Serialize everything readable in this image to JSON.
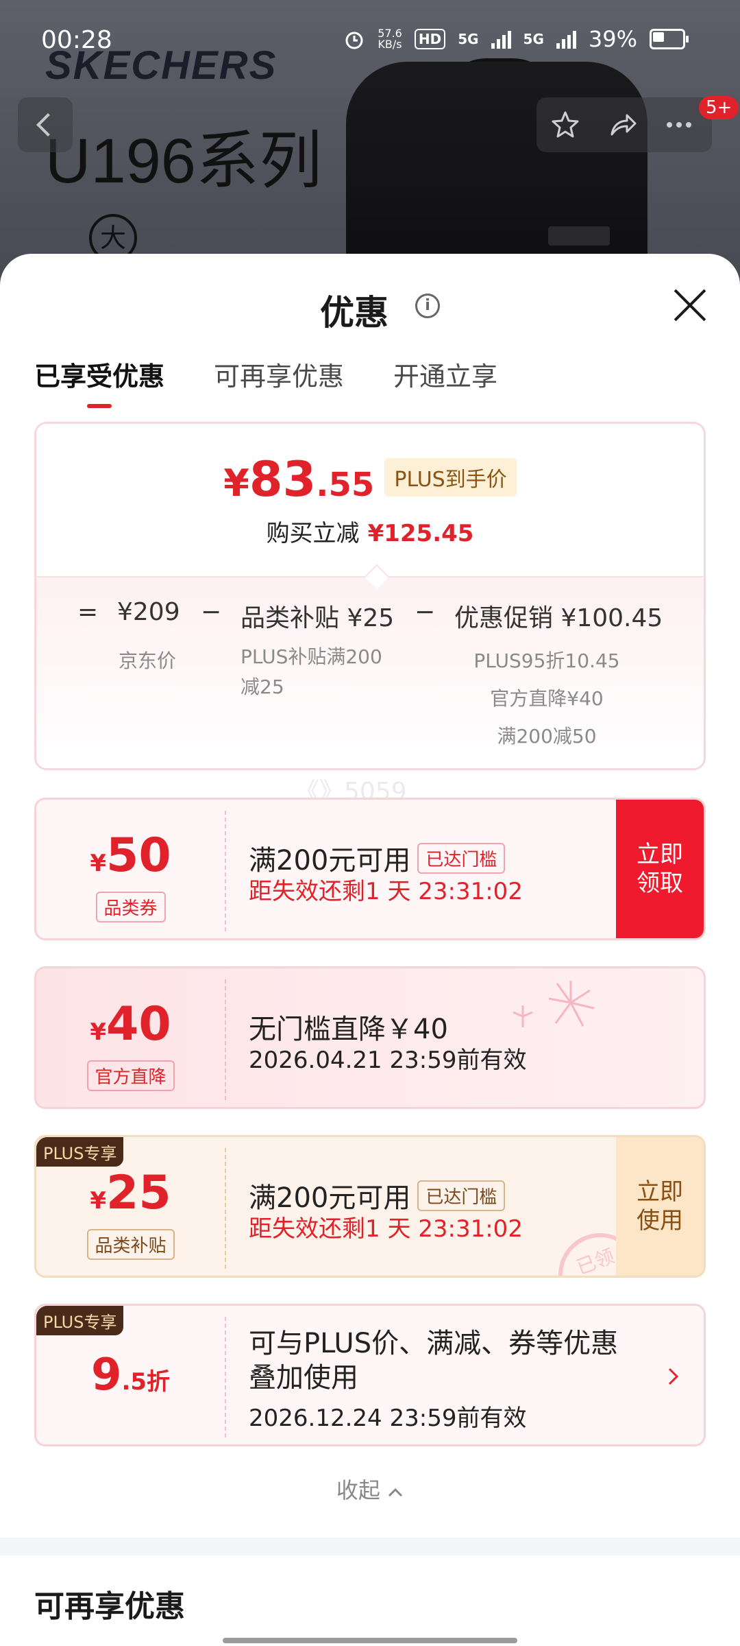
{
  "status_bar": {
    "time": "00:28",
    "net_speed_value": "57.6",
    "net_speed_unit": "KB/s",
    "hd": "HD",
    "sim1": "5G",
    "sim2": "5G",
    "battery": "39%"
  },
  "product_header": {
    "brand": "SKECHERS",
    "series": "U196系列",
    "circle_char": "大",
    "cart_badge": "5+"
  },
  "sheet": {
    "title": "优惠",
    "tabs": [
      {
        "label": "已享受优惠",
        "active": true
      },
      {
        "label": "可再享优惠",
        "active": false
      },
      {
        "label": "开通立享",
        "active": false
      }
    ]
  },
  "price_card": {
    "yen": "¥",
    "final_int": "83",
    "final_frac": ".55",
    "plus_tag": "PLUS到手价",
    "reduce_label": "购买立减",
    "reduce_value": "¥125.45",
    "formula": {
      "equals": "=",
      "jd_price": "¥209",
      "minus1": "−",
      "category_subsidy": "品类补贴 ¥25",
      "minus2": "−",
      "promotion": "优惠促销 ¥100.45",
      "jd_price_label": "京东价",
      "subsidy_detail_1": "PLUS补贴满200",
      "subsidy_detail_2": "减25",
      "promo_detail_1": "PLUS95折10.45",
      "promo_detail_2": "官方直降¥40",
      "promo_detail_3": "满200减50"
    }
  },
  "watermark": "《》5059",
  "coupons": [
    {
      "yen": "¥",
      "amount": "50",
      "label": "品类券",
      "title": "满200元可用",
      "threshold": "已达门槛",
      "subtitle": "距失效还剩1 天 23:31:02",
      "action_line1": "立即",
      "action_line2": "领取"
    },
    {
      "yen": "¥",
      "amount": "40",
      "label": "官方直降",
      "title": "无门槛直降￥40",
      "subtitle": "2026.04.21 23:59前有效"
    },
    {
      "plus_corner": "PLUS专享",
      "yen": "¥",
      "amount": "25",
      "label": "品类补贴",
      "title": "满200元可用",
      "threshold": "已达门槛",
      "subtitle": "距失效还剩1 天 23:31:02",
      "action_line1": "立即",
      "action_line2": "使用",
      "stamp": "已领"
    },
    {
      "plus_corner": "PLUS专享",
      "discount_int": "9",
      "discount_frac": ".5折",
      "title_line1": "可与PLUS价、满减、券等优惠",
      "title_line2": "叠加使用",
      "subtitle": "2026.12.24 23:59前有效"
    }
  ],
  "collapse_label": "收起",
  "more_section_title": "可再享优惠",
  "colors": {
    "accent_red": "#e0232b",
    "plus_brown": "#4a2b1a",
    "plus_gold_bg": "#fdf0d6"
  }
}
